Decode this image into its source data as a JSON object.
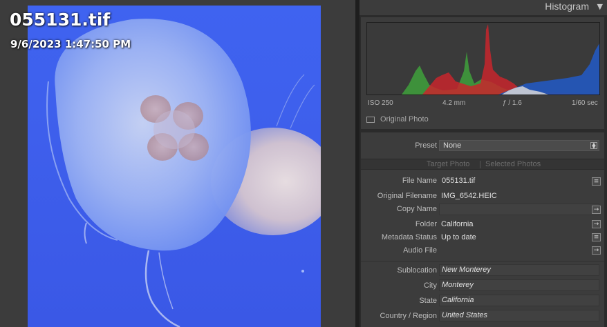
{
  "photo": {
    "filename_overlay": "055131.tif",
    "datetime_overlay": "9/6/2023 1:47:50 PM"
  },
  "histogram": {
    "title": "Histogram",
    "iso": "ISO 250",
    "focal": "4.2 mm",
    "aperture": "ƒ / 1.6",
    "shutter": "1/60 sec",
    "original_photo_label": "Original Photo"
  },
  "metadata": {
    "preset_label": "Preset",
    "preset_value": "None",
    "tab_target": "Target Photo",
    "tab_selected": "Selected Photos",
    "fields": [
      {
        "label": "File Name",
        "value": "055131.tif"
      },
      {
        "label": "Original Filename",
        "value": "IMG_6542.HEIC"
      },
      {
        "label": "Copy Name",
        "value": ""
      },
      {
        "label": "Folder",
        "value": "California"
      },
      {
        "label": "Metadata Status",
        "value": "Up to date"
      },
      {
        "label": "Audio File",
        "value": ""
      }
    ],
    "location": [
      {
        "label": "Sublocation",
        "value": "New Monterey"
      },
      {
        "label": "City",
        "value": "Monterey"
      },
      {
        "label": "State",
        "value": "California"
      },
      {
        "label": "Country / Region",
        "value": "United States"
      }
    ]
  },
  "colors": {
    "hist_red": "#c8262d",
    "hist_green": "#3f9b3c",
    "hist_blue": "#2456b8",
    "photo_blue": "#3f63f0"
  }
}
